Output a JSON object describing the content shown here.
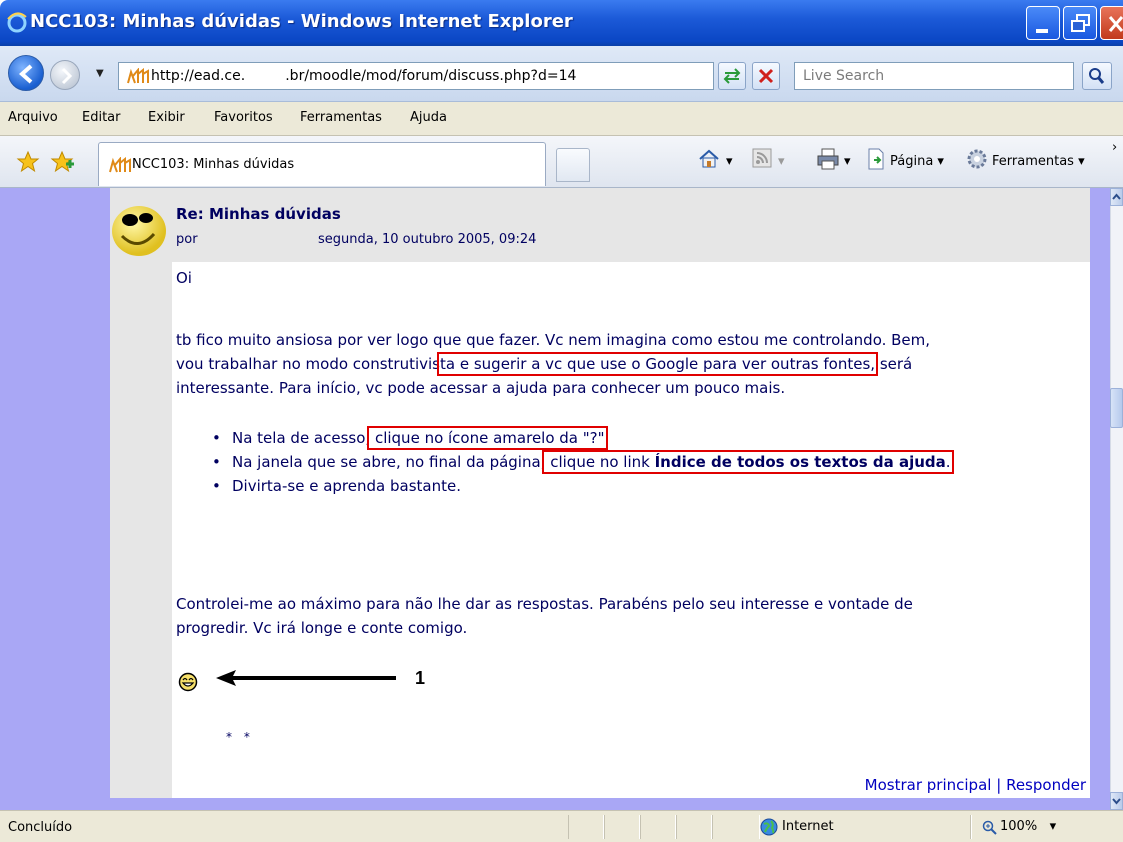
{
  "window": {
    "title": "NCC103: Minhas dúvidas - Windows Internet Explorer"
  },
  "address_bar": {
    "url": "http://ead.ce.         .br/moodle/mod/forum/discuss.php?d=14",
    "search_placeholder": "Live Search"
  },
  "menu": {
    "items": [
      {
        "label": "Arquivo"
      },
      {
        "label": "Editar"
      },
      {
        "label": "Exibir"
      },
      {
        "label": "Favoritos"
      },
      {
        "label": "Ferramentas"
      },
      {
        "label": "Ajuda"
      }
    ]
  },
  "tabs": {
    "active_label": "NCC103: Minhas dúvidas"
  },
  "command_bar": {
    "page_label": "Página",
    "tools_label": "Ferramentas"
  },
  "post": {
    "title": "Re: Minhas dúvidas",
    "by": "por",
    "date": "segunda, 10 outubro 2005, 09:24",
    "greeting": "Oi",
    "para1_a": "tb fico muito ansiosa por ver logo que que fazer. Vc nem imagina como estou me controlando. Bem,",
    "para1_b_pre": "vou trabalhar no modo construtivis",
    "para1_b_hl": "ta e sugerir a vc que use o Google para ver outras fontes,",
    "para1_b_post": " será",
    "para1_c": "interessante. Para início, vc pode acessar a ajuda para conhecer um pouco mais.",
    "bullets": {
      "b1_pre": "Na tela de acesso,",
      "b1_hl": " clique no ícone amarelo da \"?\"",
      "b2_pre": "Na janela que se abre, no final da página,",
      "b2_hl_a": " clique no link ",
      "b2_hl_b": "Índice de todos os textos da ajuda",
      "b2_post": ".",
      "b3": "Divirta-se e aprenda bastante."
    },
    "para2_a": "Controlei-me ao máximo para não lhe dar as respostas. Parabéns pelo seu interesse e vontade de",
    "para2_b": "progredir. Vc irá longe e conte comigo.",
    "annotation_number": "1",
    "stars": "* *",
    "link_parent": "Mostrar principal",
    "link_separator": "|",
    "link_reply": "Responder"
  },
  "status_bar": {
    "status": "Concluído",
    "zone": "Internet",
    "zoom": "100%"
  },
  "colors": {
    "content_bg": "#a9a7f5",
    "text": "#000060",
    "link": "#0000c0",
    "highlight_box": "#e00000"
  },
  "icons": [
    "ie-logo-icon",
    "back-icon",
    "forward-icon",
    "moodle-icon",
    "refresh-icon",
    "stop-icon",
    "search-icon",
    "favorites-star-icon",
    "add-favorite-icon",
    "home-icon",
    "feeds-icon",
    "print-icon",
    "page-icon",
    "tools-gear-icon",
    "globe-icon",
    "zoom-icon",
    "smiley-icon",
    "avatar-smiley-icon",
    "arrow-icon"
  ]
}
